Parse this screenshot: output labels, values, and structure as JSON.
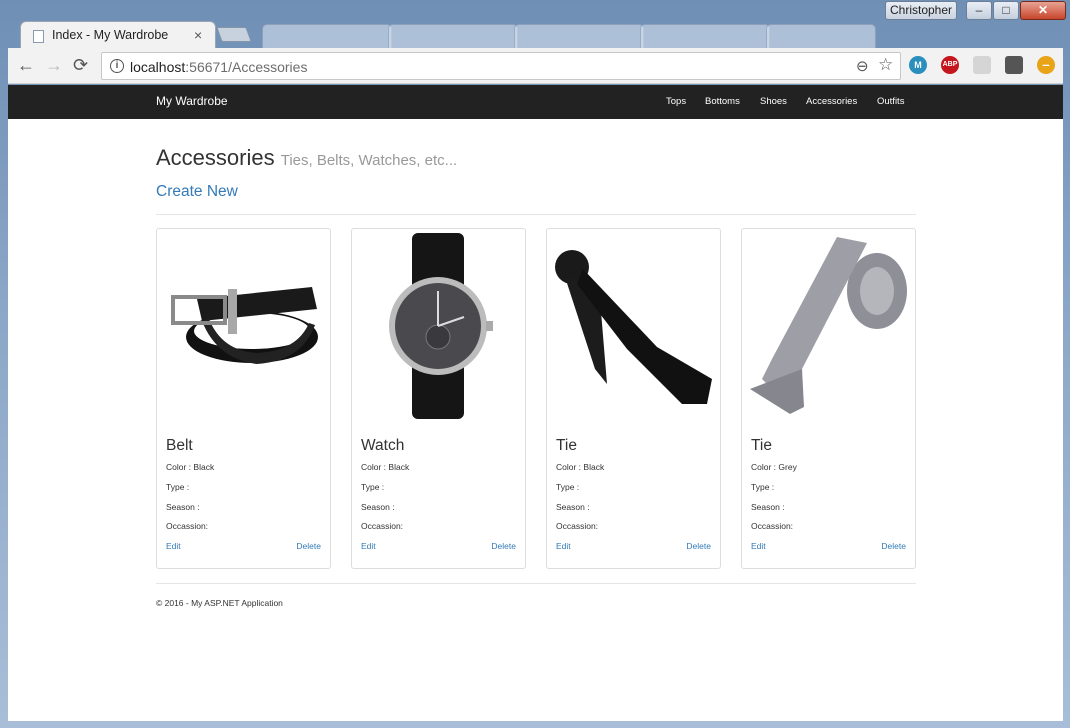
{
  "window": {
    "user": "Christopher",
    "min_glyph": "‒",
    "max_glyph": "□",
    "close_glyph": "✕"
  },
  "tabs": {
    "active_title": "Index - My Wardrobe",
    "close_glyph": "×"
  },
  "toolbar": {
    "back_glyph": "←",
    "forward_glyph": "→",
    "reload_glyph": "⟳",
    "url_host": "localhost",
    "url_path": ":56671/Accessories",
    "zoom_glyph": "⊖",
    "star_glyph": "☆",
    "extensions": [
      {
        "label": "M",
        "icon": "m-extension-icon",
        "color": "#2a8fbd"
      },
      {
        "label": "ABP",
        "icon": "adblock-icon",
        "color": "#c4161c"
      },
      {
        "label": "",
        "icon": "cup-extension-icon",
        "color": "#d5d5d5"
      },
      {
        "label": "",
        "icon": "bulb-extension-icon",
        "color": "#555555"
      },
      {
        "label": "–",
        "icon": "minus-extension-icon",
        "color": "#e8a317"
      }
    ]
  },
  "navbar": {
    "brand": "My Wardrobe",
    "links": [
      "Tops",
      "Bottoms",
      "Shoes",
      "Accessories",
      "Outfits"
    ]
  },
  "main": {
    "title": "Accessories",
    "subtitle": "Ties, Belts, Watches, etc...",
    "create_link": "Create New",
    "labels": {
      "color": "Color :",
      "type": "Type :",
      "season": "Season :",
      "occasion": "Occassion:",
      "edit": "Edit",
      "delete": "Delete"
    },
    "items": [
      {
        "name": "Belt",
        "color": "Black",
        "type": "",
        "season": "",
        "occasion": "",
        "image": "black-belt"
      },
      {
        "name": "Watch",
        "color": "Black",
        "type": "",
        "season": "",
        "occasion": "",
        "image": "black-watch"
      },
      {
        "name": "Tie",
        "color": "Black",
        "type": "",
        "season": "",
        "occasion": "",
        "image": "black-tie"
      },
      {
        "name": "Tie",
        "color": "Grey",
        "type": "",
        "season": "",
        "occasion": "",
        "image": "grey-tie"
      }
    ]
  },
  "footer": {
    "text": "© 2016 - My ASP.NET Application"
  },
  "colors": {
    "navbar_bg": "#222222",
    "link": "#337ab7",
    "subtitle": "#999999"
  }
}
